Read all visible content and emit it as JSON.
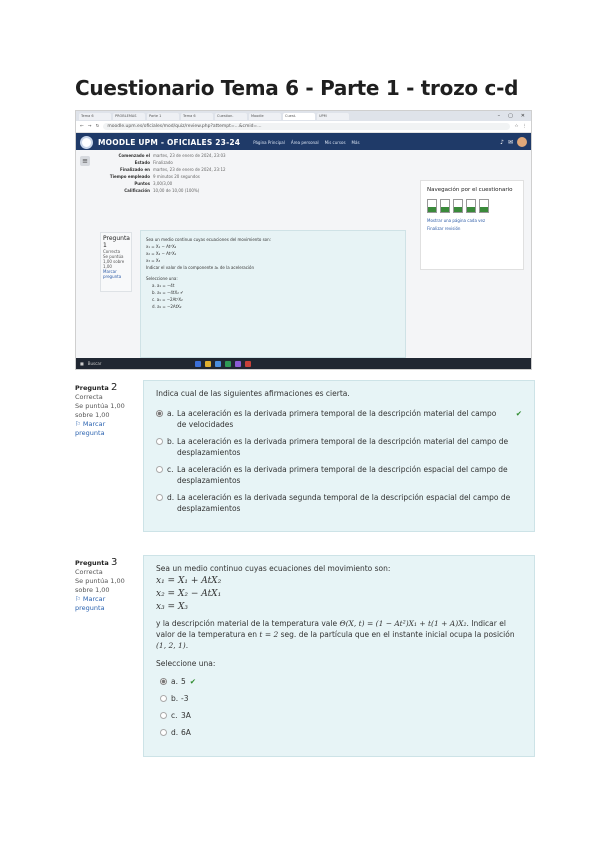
{
  "document_title": "Cuestionario Tema 6 - Parte 1 - trozo c-d",
  "screenshot": {
    "browser": {
      "url": "moodle.upm.es/oficiales/mod/quiz/review.php?attempt=...&cmid=...",
      "tabs": [
        "Tema 6",
        "PROBLEMAS",
        "Parte 1",
        "Tema 6",
        "Cuestion.",
        "Moodle",
        "Cuest.",
        "UPM"
      ]
    },
    "moodle": {
      "brand": "MOODLE UPM - OFICIALES 23-24",
      "nav_links": [
        "Página Principal",
        "Área personal",
        "Mis cursos",
        "Más"
      ],
      "summary": [
        {
          "k": "Comenzado el",
          "v": "martes, 23 de enero de 2024, 23:03"
        },
        {
          "k": "Estado",
          "v": "Finalizado"
        },
        {
          "k": "Finalizado en",
          "v": "martes, 23 de enero de 2024, 23:12"
        },
        {
          "k": "Tiempo empleado",
          "v": "9 minutos 20 segundos"
        },
        {
          "k": "Puntos",
          "v": "3,00/3,00"
        },
        {
          "k": "Calificación",
          "v": "10,00 de 10,00 (100%)"
        }
      ],
      "q1": {
        "title": "Pregunta 1",
        "state": "Correcta",
        "marks": "Se puntúa 1,00 sobre 1,00",
        "flag": "Marcar pregunta",
        "lines": [
          "Sea un medio continuo cuyas ecuaciones del movimiento son:",
          "x₁ = X₁ − At²X₂",
          "x₂ = X₂ − At²X₁",
          "x₃ = X₃",
          "Indicar el valor de la componente a₁ de la aceleración",
          "Seleccione una:",
          "a.  a₁ = −4t",
          "b.  a₁ = −4tX₂ ✔",
          "c.  a₁ = −2At²X₂",
          "d.  a₁ = −2AtX₂"
        ]
      },
      "nav_panel": {
        "title": "Navegación por el cuestionario",
        "cells": [
          "1",
          "2",
          "3",
          "4",
          "5"
        ],
        "links": [
          "Mostrar una página cada vez",
          "Finalizar revisión"
        ]
      },
      "taskbar_search": "Buscar"
    }
  },
  "questions": [
    {
      "number_label": "Pregunta",
      "number": "2",
      "state": "Correcta",
      "marks": "Se puntúa 1,00 sobre 1,00",
      "flag": "Marcar pregunta",
      "prompt": "Indica cual de las siguientes afirmaciones es cierta.",
      "options": [
        {
          "letter": "a.",
          "text": "La aceleración es la derivada primera temporal de la descripción material del campo de velocidades",
          "selected": true,
          "correct": true
        },
        {
          "letter": "b.",
          "text": "La aceleración es la derivada primera temporal de la descripción material del campo de desplazamientos",
          "selected": false,
          "correct": false
        },
        {
          "letter": "c.",
          "text": "La aceleración es la derivada primera temporal de la descripción espacial del campo de desplazamientos",
          "selected": false,
          "correct": false
        },
        {
          "letter": "d.",
          "text": "La aceleración es la derivada segunda temporal de la descripción espacial del campo de desplazamientos",
          "selected": false,
          "correct": false
        }
      ]
    },
    {
      "number_label": "Pregunta",
      "number": "3",
      "state": "Correcta",
      "marks": "Se puntúa 1,00 sobre 1,00",
      "flag": "Marcar pregunta",
      "prompt": "Sea un medio continuo cuyas ecuaciones del movimiento son:",
      "equations": [
        "x₁ = X₁ + AtX₂",
        "x₂ = X₂ − AtX₁",
        "x₃ = X₃"
      ],
      "text_a": "y la descripción material de la temperatura vale ",
      "formula_a": "Θ(X, t) = (1 − At²)X₁ + t(1 + A)X₂",
      "text_b": ". Indicar el valor de la temperatura en ",
      "formula_b": "t = 2",
      "text_c": " seg. de la partícula que en el instante inicial ocupa la posición ",
      "formula_c": "(1, 2, 1)",
      "text_d": ".",
      "select_label": "Seleccione una:",
      "options": [
        {
          "letter": "a.",
          "text": "5",
          "selected": true,
          "correct": true
        },
        {
          "letter": "b.",
          "text": "-3",
          "selected": false,
          "correct": false
        },
        {
          "letter": "c.",
          "text": "3A",
          "selected": false,
          "correct": false
        },
        {
          "letter": "d.",
          "text": "6A",
          "selected": false,
          "correct": false
        }
      ]
    }
  ],
  "colors": {
    "moodle_nav": "#1f3a68",
    "card_bg": "#e7f4f6",
    "correct": "#2e8b2e"
  }
}
